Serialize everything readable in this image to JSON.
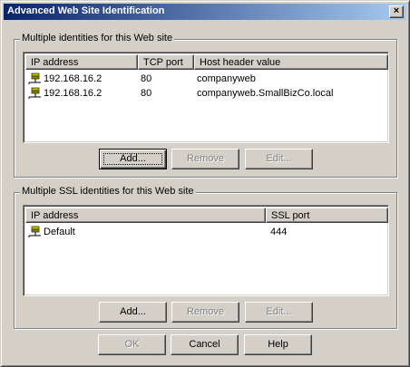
{
  "window": {
    "title": "Advanced Web Site Identification",
    "close_glyph": "×"
  },
  "identities": {
    "group_label": "Multiple identities for this Web site",
    "columns": [
      "IP address",
      "TCP port",
      "Host header value"
    ],
    "rows": [
      {
        "ip": "192.168.16.2",
        "port": "80",
        "host": "companyweb"
      },
      {
        "ip": "192.168.16.2",
        "port": "80",
        "host": "companyweb.SmallBizCo.local"
      }
    ],
    "buttons": {
      "add": "Add...",
      "remove": "Remove",
      "edit": "Edit..."
    }
  },
  "ssl": {
    "group_label": "Multiple SSL identities for this Web site",
    "columns": [
      "IP address",
      "SSL port"
    ],
    "rows": [
      {
        "ip": "Default",
        "port": "444"
      }
    ],
    "buttons": {
      "add": "Add...",
      "remove": "Remove",
      "edit": "Edit..."
    }
  },
  "footer": {
    "ok": "OK",
    "cancel": "Cancel",
    "help": "Help"
  },
  "icons": {
    "row_icon": "network-server-icon"
  },
  "colors": {
    "titlebar_start": "#0a246a",
    "titlebar_end": "#a6caf0",
    "face": "#d4d0c8"
  }
}
